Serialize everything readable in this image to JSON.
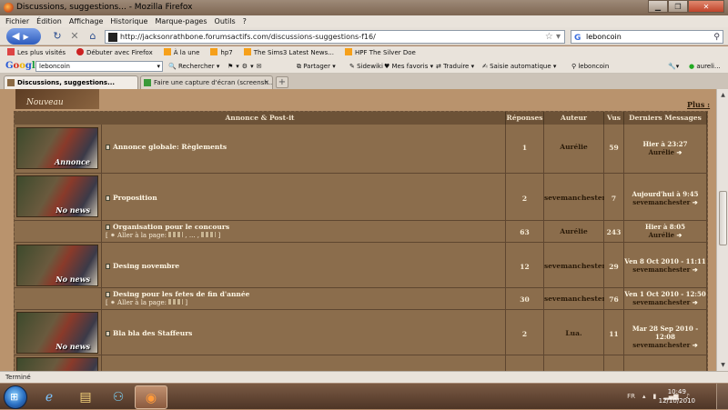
{
  "window": {
    "title": "Discussions, suggestions... - Mozilla Firefox"
  },
  "menu": [
    "Fichier",
    "Édition",
    "Affichage",
    "Historique",
    "Marque-pages",
    "Outils",
    "?"
  ],
  "nav": {
    "url": "http://jacksonrathbone.forumsactifs.com/discussions-suggestions-f16/",
    "search_value": "leboncoin"
  },
  "bookmarks": [
    "Les plus visités",
    "Débuter avec Firefox",
    "À la une",
    "hp7",
    "The Sims3 Latest News...",
    "HPF The Silver Doe"
  ],
  "google_toolbar": {
    "search_value": "leboncoin",
    "items": [
      "Rechercher",
      "Partager",
      "Sidewiki",
      "Mes favoris",
      "Traduire",
      "Saisie automatique",
      "leboncoin",
      "aureli..."
    ]
  },
  "tabs": [
    {
      "label": "Discussions, suggestions...",
      "active": true
    },
    {
      "label": "Faire une capture d'écran (screensh...",
      "active": false
    }
  ],
  "page": {
    "banner": "Nouveau",
    "more_link": "Plus :",
    "headers": [
      "Annonce & Post-it",
      "Réponses",
      "Auteur",
      "Vus",
      "Derniers Messages"
    ],
    "topics": [
      {
        "thumb_label": "Annonce",
        "title": "Annonce globale: Règlements",
        "replies": "1",
        "author": "Aurélie",
        "views": "59",
        "last_date": "Hier à 23:27",
        "last_user": "Aurélie"
      },
      {
        "thumb_label": "No news",
        "title": "Proposition",
        "replies": "2",
        "author": "sevemanchester",
        "views": "7",
        "last_date": "Aujourd'hui à 9:45",
        "last_user": "sevemanchester"
      },
      {
        "thumb_label": "",
        "title": "Organisation pour le concours",
        "goto": "[ ⁕ Aller à la page: ",
        "replies": "63",
        "author": "Aurélie",
        "views": "243",
        "last_date": "Hier à 8:05",
        "last_user": "Aurélie"
      },
      {
        "thumb_label": "No news",
        "title": "Desing novembre",
        "replies": "12",
        "author": "sevemanchester",
        "views": "29",
        "last_date": "Ven 8 Oct 2010 - 11:11",
        "last_user": "sevemanchester"
      },
      {
        "thumb_label": "",
        "title": "Desing pour les fetes de fin d'année",
        "goto": "[ ⁕ Aller à la page: ",
        "replies": "30",
        "author": "sevemanchester",
        "views": "76",
        "last_date": "Ven 1 Oct 2010 - 12:50",
        "last_user": "sevemanchester"
      },
      {
        "thumb_label": "No news",
        "title": "Bla bla des Staffeurs",
        "replies": "2",
        "author": "Lua.",
        "views": "11",
        "last_date": "Mar 28 Sep 2010 - 12:08",
        "last_user": "sevemanchester"
      }
    ]
  },
  "status": {
    "text": "Terminé"
  },
  "taskbar": {
    "lang": "FR",
    "time": "10:49",
    "date": "12/10/2010"
  }
}
